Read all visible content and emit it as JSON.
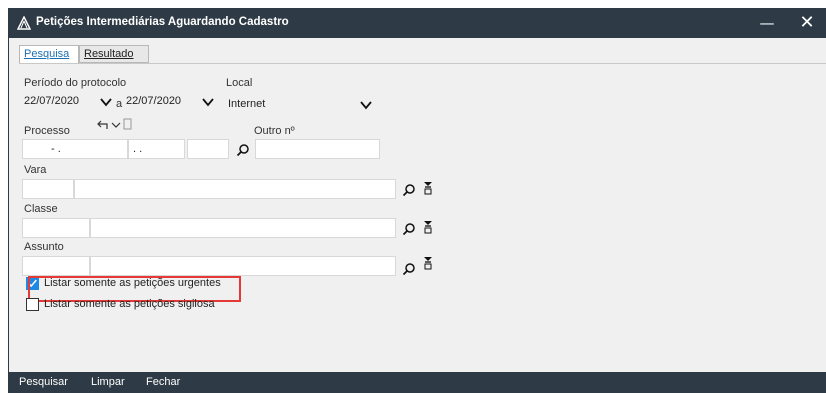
{
  "window": {
    "title": "Petições Intermediárias Aguardando Cadastro",
    "minimize_glyph": "—",
    "close_glyph": "✕"
  },
  "tabs": [
    {
      "label": "Pesquisa",
      "active": true
    },
    {
      "label": "Resultado",
      "active": false
    }
  ],
  "form": {
    "periodo_label": "Período do protocolo",
    "date_from": "22/07/2020",
    "date_sep": "a",
    "date_to": "22/07/2020",
    "local_label": "Local",
    "local_value": "Internet",
    "processo_label": "Processo",
    "processo_part1": "- .",
    "processo_part2": ". .",
    "outro_label": "Outro nº",
    "vara_label": "Vara",
    "classe_label": "Classe",
    "assunto_label": "Assunto"
  },
  "checkboxes": [
    {
      "label": "Listar somente as petições urgentes",
      "checked": true
    },
    {
      "label": "Listar somente as petições sigilosa",
      "checked": false
    }
  ],
  "bottom_actions": [
    {
      "label": "Pesquisar"
    },
    {
      "label": "Limpar"
    },
    {
      "label": "Fechar"
    }
  ],
  "colors": {
    "titlebar": "#2e3a45",
    "accent": "#1e88e5",
    "highlight": "#e53935"
  }
}
